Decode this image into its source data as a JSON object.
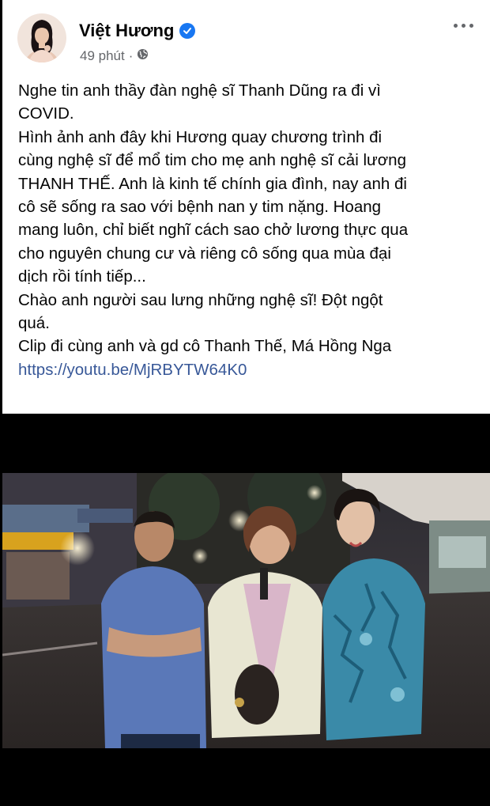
{
  "author": {
    "name": "Việt Hương",
    "verified": true,
    "verified_icon": "verified-badge-icon"
  },
  "meta": {
    "time": "49 phút",
    "separator": "·",
    "audience_icon": "globe-icon"
  },
  "more_icon": "more-options-icon",
  "post": {
    "lines": [
      "Nghe tin anh thầy đàn nghệ sĩ Thanh Dũng ra đi vì",
      "COVID.",
      "Hình ảnh anh đây khi Hương quay chương trình đi",
      "cùng nghệ sĩ để mổ tim cho mẹ anh nghệ sĩ cải lương",
      "THANH THẾ. Anh là kinh tế chính gia đình, nay anh đi",
      "cô sẽ sống ra sao với bệnh nan y tim nặng. Hoang",
      "mang luôn, chỉ biết nghĩ cách sao chở lương thực qua",
      "cho nguyên chung cư và riêng cô sống qua mùa đại",
      "dịch rồi tính tiếp...",
      "Chào anh người sau lưng những nghệ sĩ! Đột ngột",
      "quá.",
      "Clip đi cùng anh và gd cô Thanh Thế, Má Hồng Nga"
    ],
    "link": "https://youtu.be/MjRBYTW64K0"
  },
  "colors": {
    "link": "#385898",
    "verified": "#1877f2",
    "meta": "#65676b"
  }
}
